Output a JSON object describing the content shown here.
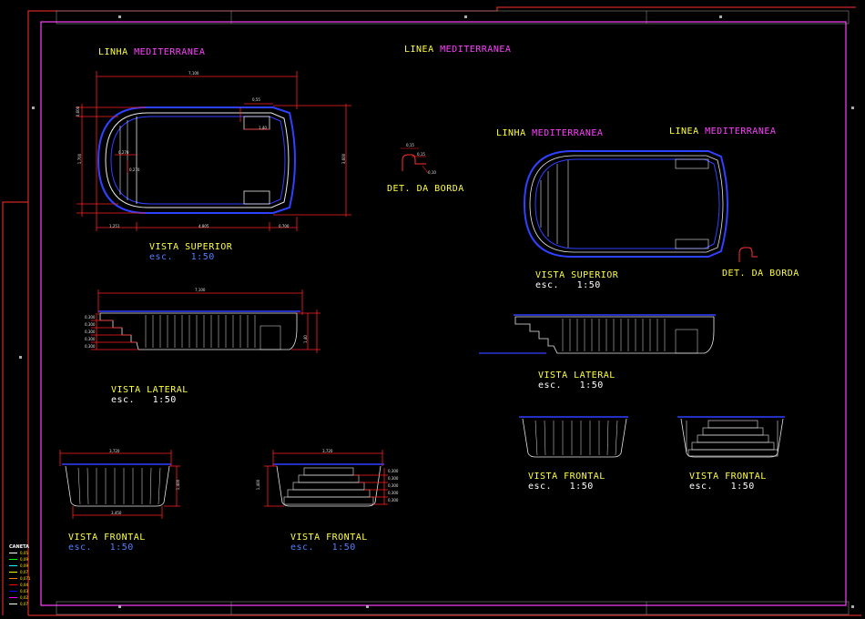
{
  "titles": {
    "top_left": {
      "prefix": "LINHA",
      "name": "MEDITERRANEA"
    },
    "top_center": {
      "prefix": "LINEA",
      "name": "MEDITERRANEA"
    },
    "right_linha": {
      "prefix": "LINHA",
      "name": "MEDITERRANEA"
    },
    "right_linea": {
      "prefix": "LINEA",
      "name": "MEDITERRANEA"
    }
  },
  "views": {
    "superior_left": {
      "title": "VISTA SUPERIOR",
      "scale_prefix": "esc.",
      "scale": "1:50"
    },
    "lateral_left": {
      "title": "VISTA LATERAL",
      "scale_prefix": "esc.",
      "scale": "1:50"
    },
    "frontal_1": {
      "title": "VISTA FRONTAL",
      "scale_prefix": "esc.",
      "scale": "1:50"
    },
    "frontal_2": {
      "title": "VISTA FRONTAL",
      "scale_prefix": "esc.",
      "scale": "1:50"
    },
    "superior_right": {
      "title": "VISTA SUPERIOR",
      "scale_prefix": "esc.",
      "scale": "1:50"
    },
    "lateral_right": {
      "title": "VISTA LATERAL",
      "scale_prefix": "esc.",
      "scale": "1:50"
    },
    "frontal_3": {
      "title": "VISTA FRONTAL",
      "scale_prefix": "esc.",
      "scale": "1:50"
    },
    "frontal_4": {
      "title": "VISTA FRONTAL",
      "scale_prefix": "esc.",
      "scale": "1:50"
    },
    "det_left": {
      "title": "DET. DA BORDA"
    },
    "det_right": {
      "title": "DET. DA BORDA"
    }
  },
  "dimensions": {
    "top_overall": "7,100",
    "top_detail": "0,55",
    "top_detail2": "1,40",
    "top_left_side": "0,600",
    "top_left_mid": "1,700",
    "top_right_tall": "3,600",
    "top_bottom_left": "1,251",
    "top_bottom_mid": "4,805",
    "top_bottom_right": "0,700",
    "top_inner_a": "0,270",
    "top_inner_b": "0,270",
    "lat_overall": "7,100",
    "lat_right": "1,40",
    "lat_steps": [
      "0,300",
      "0,300",
      "0,300",
      "0,300",
      "0,300"
    ],
    "fr1_top": "3,720",
    "fr1_bottom": "3,450",
    "fr1_side": "1,400",
    "fr2_top": "3,720",
    "fr2_side": "1,400",
    "fr2_steps": [
      "0,300",
      "0,300",
      "0,300",
      "0,300",
      "0,300"
    ],
    "det_a": "0,15",
    "det_b": "0,15",
    "det_c": "0,10"
  },
  "legend": {
    "header": "CANETA",
    "items": [
      {
        "color": "#ffffff",
        "label": "0,05"
      },
      {
        "color": "#00ff00",
        "label": "0,09"
      },
      {
        "color": "#00ffff",
        "label": "0,09"
      },
      {
        "color": "#ffff00",
        "label": "0,07"
      },
      {
        "color": "#ff8000",
        "label": "0,071"
      },
      {
        "color": "#ff0000",
        "label": "0,04"
      },
      {
        "color": "#0000ff",
        "label": "0,03"
      },
      {
        "color": "#ff00ff",
        "label": "0,02"
      },
      {
        "color": "#ffffff",
        "label": "0,07"
      }
    ]
  },
  "colors": {
    "background": "#000000",
    "sheet_border": "#ff40ff",
    "outer_frame": "#ff3030",
    "pool_outline": "#3040ff",
    "pool_body": "#e8e8e8",
    "dimension": "#ff2020",
    "title_yellow": "#ffff40",
    "title_magenta": "#ff40ff",
    "scale_blue": "#5080ff"
  }
}
